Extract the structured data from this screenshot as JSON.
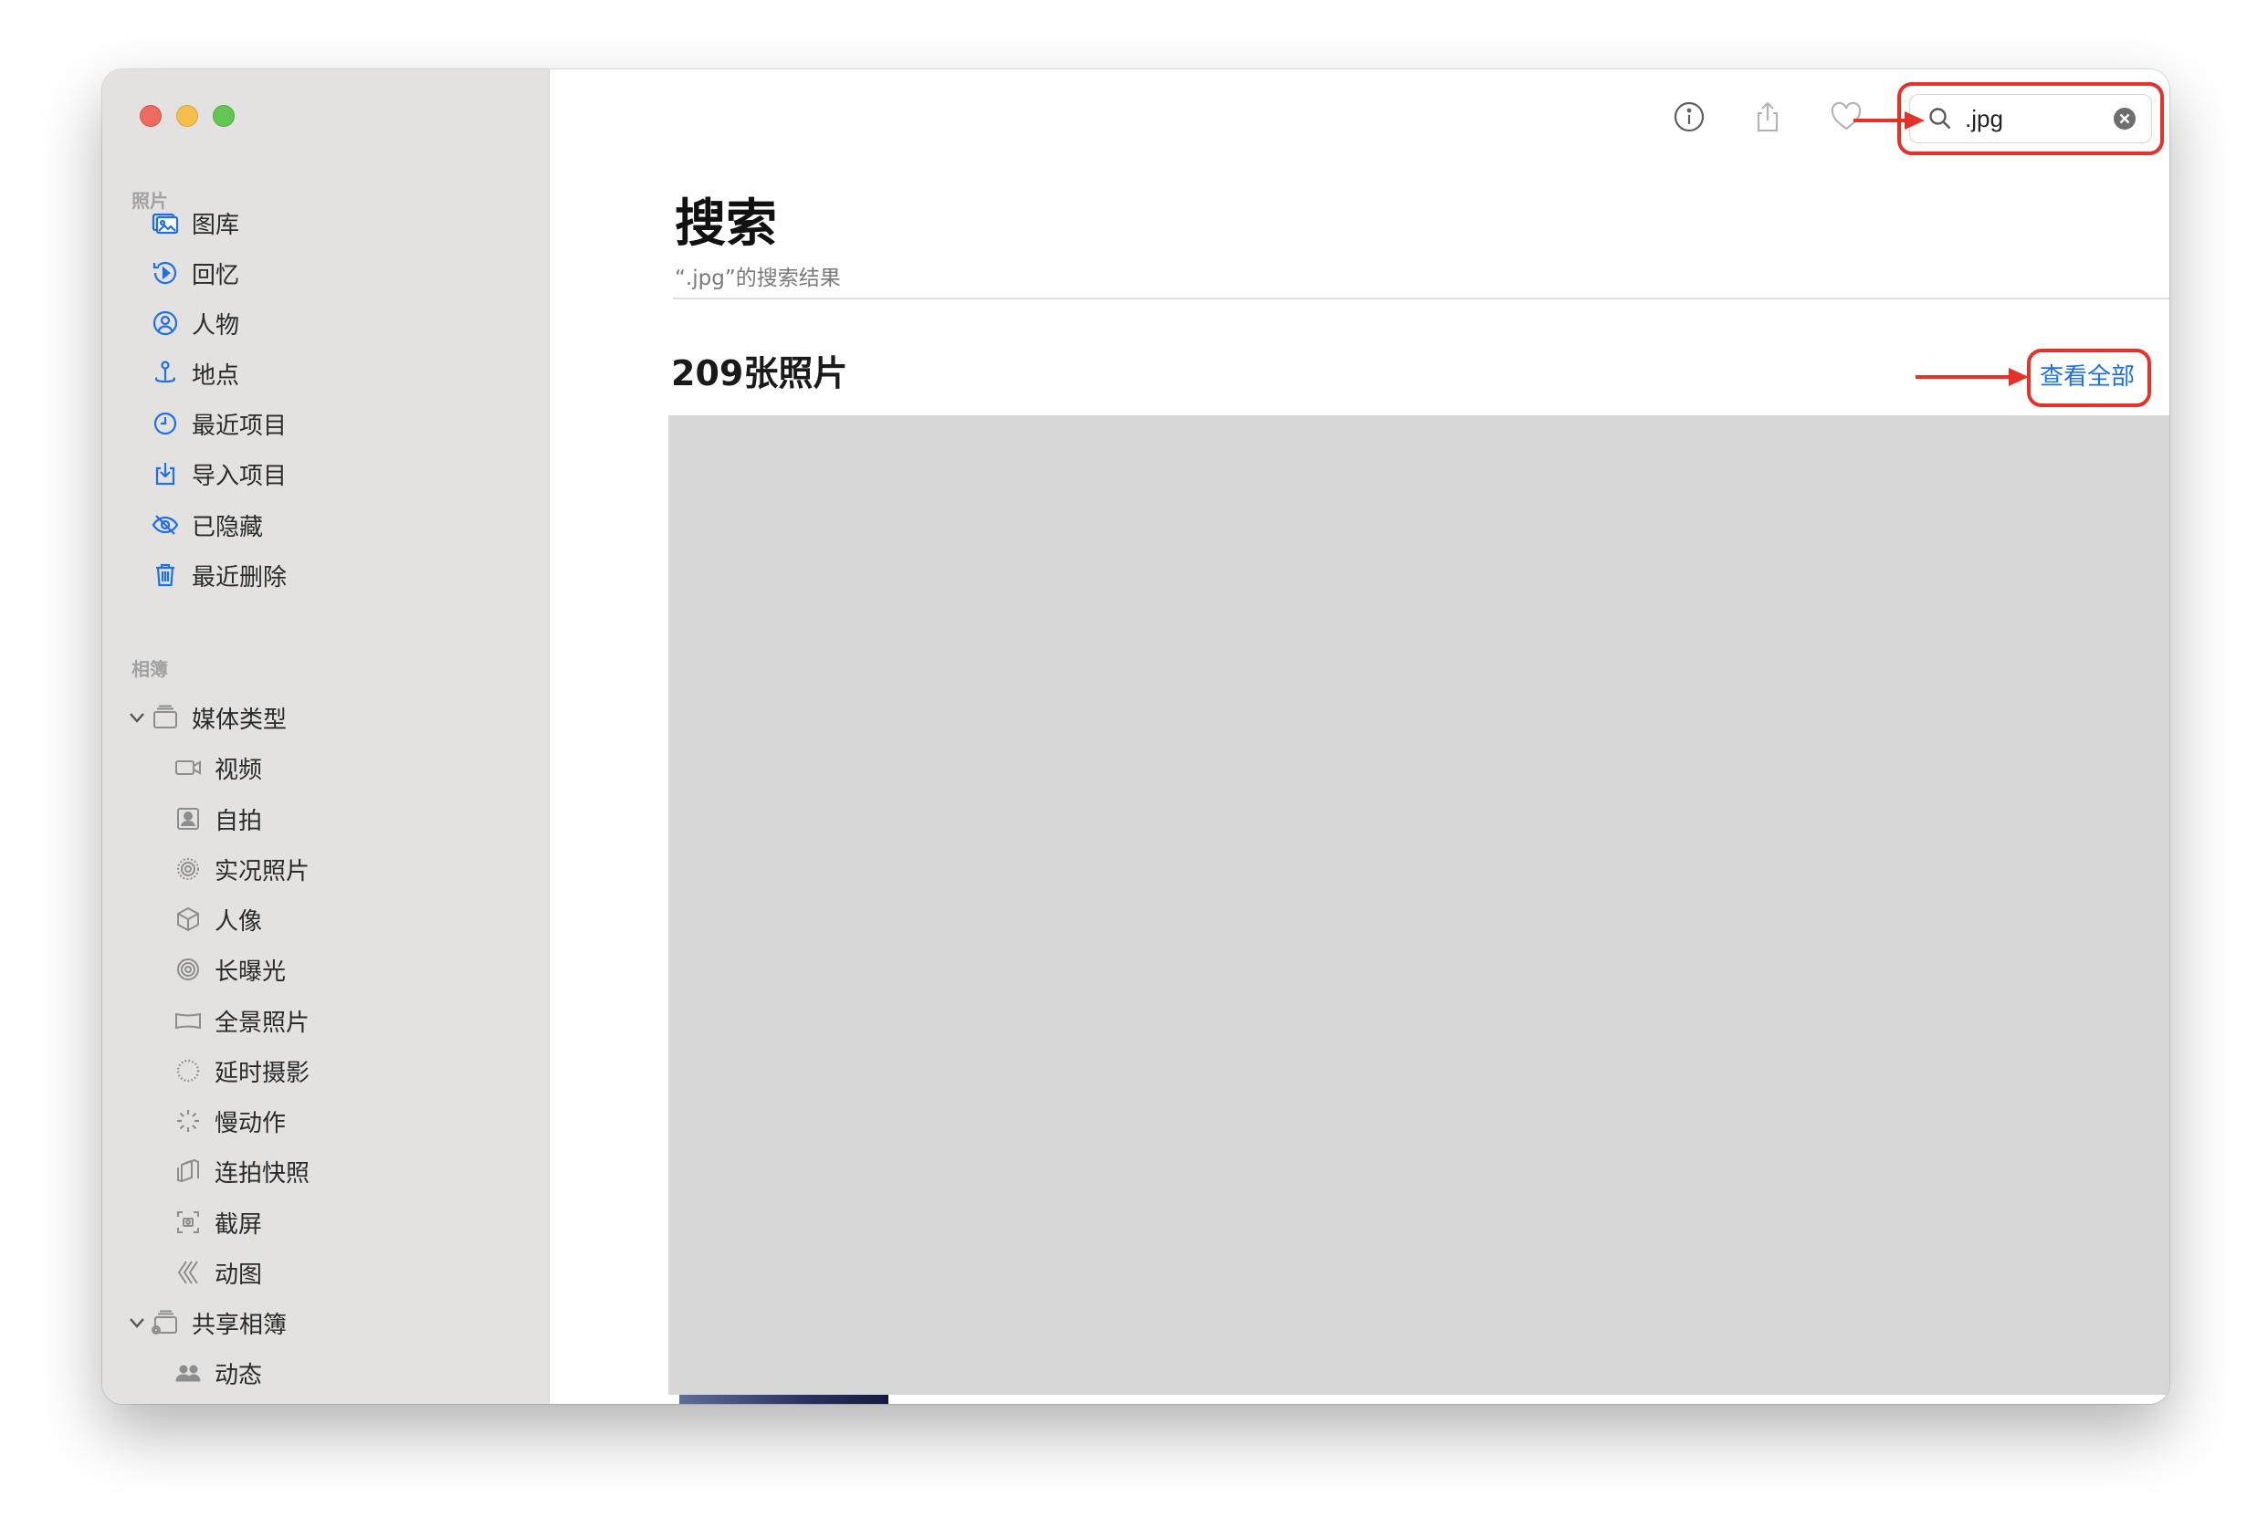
{
  "sidebar": {
    "section_photos": "照片",
    "section_albums": "相簿",
    "photos_items": [
      {
        "label": "图库",
        "icon": "photo-library-icon"
      },
      {
        "label": "回忆",
        "icon": "memories-icon"
      },
      {
        "label": "人物",
        "icon": "people-icon"
      },
      {
        "label": "地点",
        "icon": "places-icon"
      },
      {
        "label": "最近项目",
        "icon": "recents-clock-icon"
      },
      {
        "label": "导入项目",
        "icon": "import-icon"
      },
      {
        "label": "已隐藏",
        "icon": "hidden-eye-icon"
      },
      {
        "label": "最近删除",
        "icon": "trash-icon"
      }
    ],
    "media_types": {
      "label": "媒体类型",
      "items": [
        {
          "label": "视频",
          "icon": "video-icon"
        },
        {
          "label": "自拍",
          "icon": "selfie-icon"
        },
        {
          "label": "实况照片",
          "icon": "live-photo-icon"
        },
        {
          "label": "人像",
          "icon": "portrait-cube-icon"
        },
        {
          "label": "长曝光",
          "icon": "long-exposure-icon"
        },
        {
          "label": "全景照片",
          "icon": "panorama-icon"
        },
        {
          "label": "延时摄影",
          "icon": "timelapse-icon"
        },
        {
          "label": "慢动作",
          "icon": "slow-motion-icon"
        },
        {
          "label": "连拍快照",
          "icon": "burst-icon"
        },
        {
          "label": "截屏",
          "icon": "screenshot-icon"
        },
        {
          "label": "动图",
          "icon": "animated-icon"
        }
      ]
    },
    "shared_albums": {
      "label": "共享相簿",
      "items": [
        {
          "label": "动态",
          "icon": "activity-people-icon"
        }
      ]
    }
  },
  "toolbar": {
    "search_value": ".jpg"
  },
  "main": {
    "title": "搜索",
    "subtitle": "“.jpg”的搜索结果",
    "count_title": "209张照片",
    "see_all": "查看全部"
  },
  "colors": {
    "accent": "#1f6fe5",
    "annotation": "#e4322b",
    "sidebar_bg": "#e3e2e1",
    "grid_placeholder": "#d7d7d7"
  }
}
